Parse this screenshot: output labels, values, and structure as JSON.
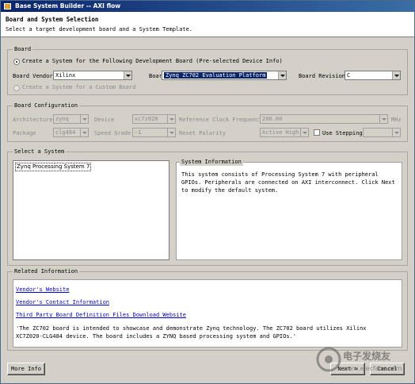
{
  "window": {
    "title": "Base System Builder -- AXI flow"
  },
  "header": {
    "title": "Board and System Selection",
    "subtitle": "Select a target development board and a System Template."
  },
  "board": {
    "group_label": "Board",
    "radio_dev_board_label": "Create a System for the Following Development Board (Pre-selected Device Info)",
    "vendor_label": "Board Vendor",
    "vendor_value": "Xilinx",
    "name_label": "Board Name",
    "name_value": "Zynq ZC702 Evaluation Platform",
    "revision_label": "Board Revision",
    "revision_value": "C",
    "radio_custom_label": "Create a System for a Custom Board"
  },
  "board_config": {
    "group_label": "Board Configuration",
    "architecture_label": "Architecture",
    "architecture_value": "zynq",
    "device_label": "Device",
    "device_value": "xc7z020",
    "ref_clock_label": "Reference Clock Frequency",
    "ref_clock_value": "200.00",
    "ref_clock_unit": "MHz",
    "package_label": "Package",
    "package_value": "clg484",
    "speed_label": "Speed Grade",
    "speed_value": "-1",
    "reset_label": "Reset Polarity",
    "reset_value": "Active High",
    "use_stepping_label": "Use Stepping"
  },
  "select_system": {
    "group_label": "Select a System",
    "list_items": [
      "Zynq Processing System 7"
    ],
    "info_label": "System Information",
    "info_text": "This system consists of Processing System 7 with peripheral GPIOs. Peripherals are connected on AXI interconnect. Click Next to modify the default system."
  },
  "related": {
    "group_label": "Related Information",
    "links": [
      "Vendor's Website",
      "Vendor's Contact Information",
      "Third Party Board Definition Files Download Website"
    ],
    "description": "'The ZC702 board is intended to showcase and demonstrate Zynq technology. The ZC702 board utilizes Xilinx XC7Z020-CLG484 device. The board includes a ZYNQ based processing system and GPIOs.'"
  },
  "buttons": {
    "more_info": "More Info",
    "next": "Next >",
    "cancel": "Cancel"
  },
  "watermark": {
    "text": "电子发烧友",
    "url": "www.elecfans.com"
  }
}
